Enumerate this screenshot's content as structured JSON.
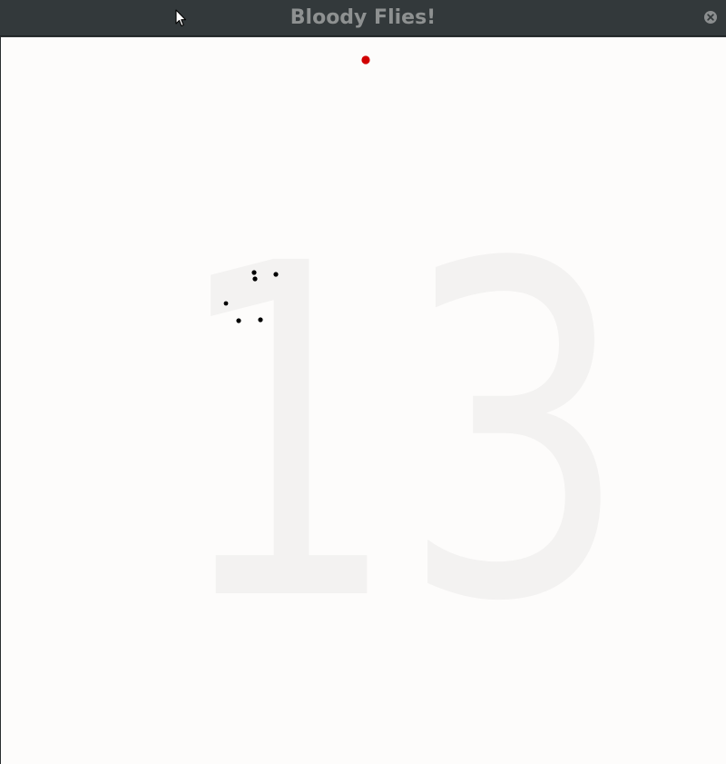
{
  "window": {
    "title": "Bloody Flies!",
    "close_icon": "close-icon"
  },
  "game": {
    "score": "13",
    "score_color": "#f3f2f1",
    "background": "#fdfcfb",
    "fly_color": "#000000",
    "blood_color": "#d10000",
    "flies_count": 6,
    "blood_splats_count": 1
  }
}
